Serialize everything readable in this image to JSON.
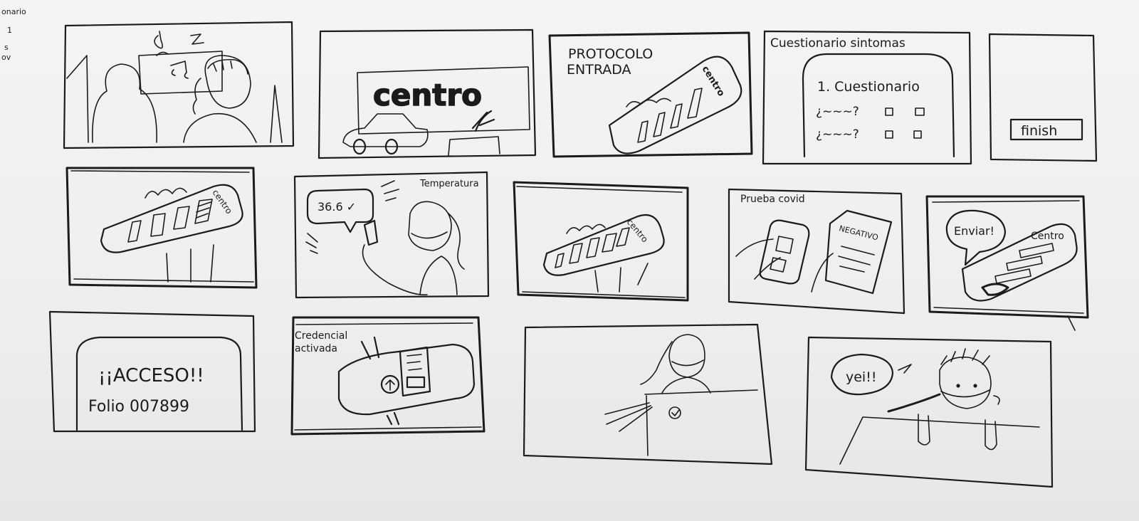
{
  "ink_color": "#1b1b1b",
  "paper_color": "#f0f0f0",
  "margin_note": [
    "onario",
    "1",
    "s",
    "ov"
  ],
  "frames": {
    "f02": {
      "sign": "centro"
    },
    "f03": {
      "title_line1": "PROTOCOLO",
      "title_line2": "ENTRADA",
      "phone_brand": "centro"
    },
    "f04": {
      "header": "Cuestionario sintomas",
      "heading": "1. Cuestionario",
      "q1": "¿~~~?",
      "q2": "¿~~~?"
    },
    "f05": {
      "button": "finish"
    },
    "f06": {
      "phone_brand": "centro"
    },
    "f07": {
      "label": "Temperatura",
      "reading": "36.6 ✓"
    },
    "f08": {
      "phone_brand": "centro"
    },
    "f09": {
      "label": "Prueba covid",
      "doc_text": "NEGATIVO"
    },
    "f10": {
      "bubble": "Enviar!",
      "phone_brand": "Centro"
    },
    "f11": {
      "line1": "¡¡ACCESO!!",
      "line2": "Folio 007899"
    },
    "f12": {
      "label_line1": "Credencial",
      "label_line2": "activada"
    },
    "f14": {
      "bubble": "yei!!"
    }
  }
}
